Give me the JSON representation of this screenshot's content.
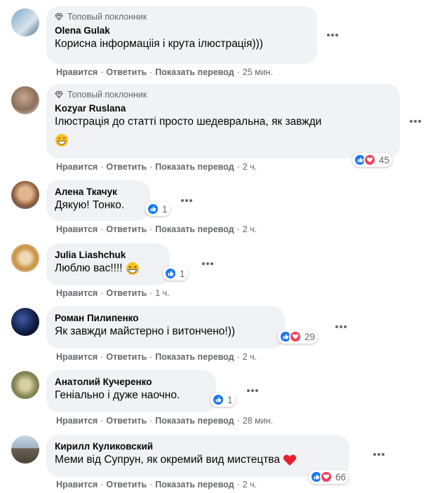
{
  "colors": {
    "accent_blue": "#1877f2",
    "love_red": "#f33e58",
    "bubble_bg": "#f0f2f5",
    "meta_text": "#65676b"
  },
  "comments": [
    {
      "badge": "Топовый поклонник",
      "author": "Olena Gulak",
      "text": "Корисна інформаціія і крута ілюстрація)))",
      "actions": {
        "like": "Нравится",
        "reply": "Ответить",
        "translate": "Показать перевод",
        "time": "25 мин."
      }
    },
    {
      "badge": "Топовый поклонник",
      "author": "Kozyar Ruslana",
      "text": "Ілюстрація до статті просто шедевральна, як завжди",
      "emoji": "grinning-face",
      "reactions": {
        "icons": [
          "like",
          "love"
        ],
        "count": "45"
      },
      "actions": {
        "like": "Нравится",
        "reply": "Ответить",
        "translate": "Показать перевод",
        "time": "2 ч."
      }
    },
    {
      "author": "Алена Ткачук",
      "text": "Дякую! Тонко.",
      "reactions": {
        "icons": [
          "like"
        ],
        "count": "1"
      },
      "actions": {
        "like": "Нравится",
        "reply": "Ответить",
        "translate": "Показать перевод",
        "time": "2 ч."
      }
    },
    {
      "author": "Julia Liashchuk",
      "text": "Люблю вас!!!!",
      "emoji": "laughing-face",
      "reactions": {
        "icons": [
          "like"
        ],
        "count": "1"
      },
      "actions": {
        "like": "Нравится",
        "reply": "Ответить",
        "time": "1 ч."
      }
    },
    {
      "author": "Роман Пилипенко",
      "text": "Як завжди майстерно і витончено!))",
      "reactions": {
        "icons": [
          "like",
          "love"
        ],
        "count": "29"
      },
      "actions": {
        "like": "Нравится",
        "reply": "Ответить",
        "translate": "Показать перевод",
        "time": "2 ч."
      }
    },
    {
      "author": "Анатолий Кучеренко",
      "text": "Геніально і дуже наочно.",
      "reactions": {
        "icons": [
          "like"
        ],
        "count": "1"
      },
      "actions": {
        "like": "Нравится",
        "reply": "Ответить",
        "translate": "Показать перевод",
        "time": "28 мин."
      }
    },
    {
      "author": "Кирилл Куликовский",
      "text": "Меми від Супрун, як окремий вид мистецтва",
      "emoji": "red-heart",
      "reactions": {
        "icons": [
          "like",
          "love"
        ],
        "count": "66"
      },
      "actions": {
        "like": "Нравится",
        "reply": "Ответить",
        "translate": "Показать перевод",
        "time": "2 ч."
      }
    }
  ]
}
